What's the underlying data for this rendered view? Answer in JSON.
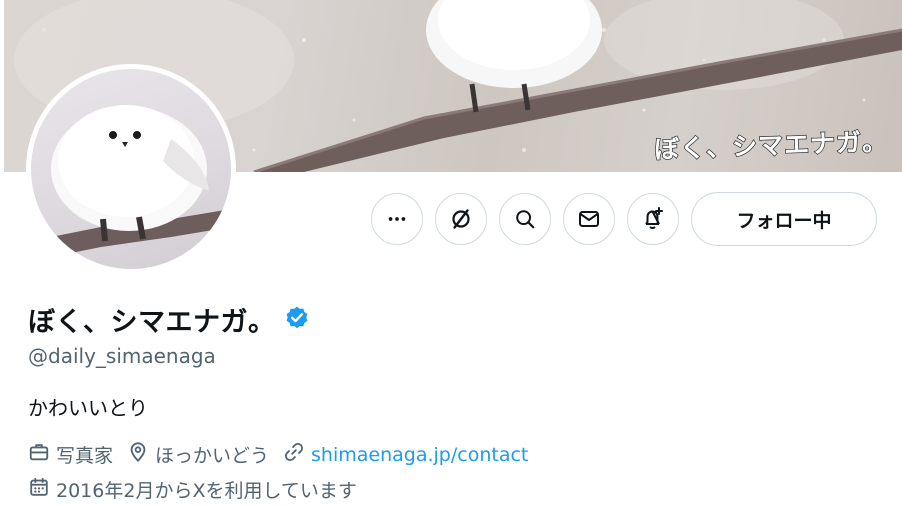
{
  "banner": {
    "logo_text": "ぼく、シマエナガ。"
  },
  "actions": {
    "more_icon": "more-horizontal-icon",
    "grok_icon": "grok-icon",
    "search_icon": "search-icon",
    "message_icon": "envelope-icon",
    "notify_icon": "bell-plus-icon",
    "follow_label": "フォロー中"
  },
  "profile": {
    "display_name": "ぼく、シマエナガ。",
    "verified": true,
    "handle": "@daily_simaenaga",
    "bio": "かわいいとり",
    "profession": "写真家",
    "location": "ほっかいどう",
    "website": "shimaenaga.jp/contact",
    "joined": "2016年2月からXを利用しています"
  },
  "colors": {
    "accent": "#1d9bf0",
    "text": "#0f1419",
    "secondary_text": "#536471",
    "border": "#cfd9de"
  }
}
